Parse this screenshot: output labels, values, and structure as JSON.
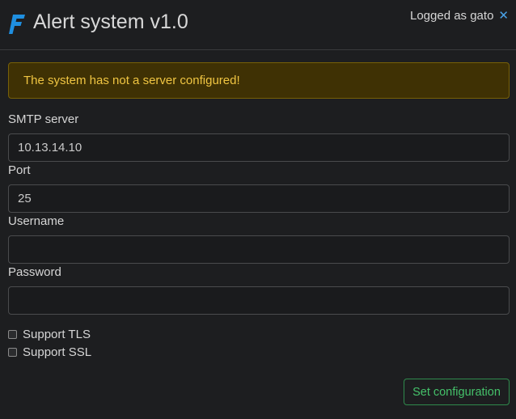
{
  "header": {
    "title": "Alert system v1.0",
    "logo_icon": "brand-f-logo-icon",
    "user_text": "Logged as gato",
    "close_glyph": "✕",
    "close_icon": "close-icon"
  },
  "alert": {
    "message": "The system has not a server configured!"
  },
  "form": {
    "smtp_label": "SMTP server",
    "smtp_value": "10.13.14.10",
    "port_label": "Port",
    "port_value": "25",
    "username_label": "Username",
    "username_value": "",
    "password_label": "Password",
    "password_value": "",
    "tls_label": "Support TLS",
    "tls_checked": false,
    "ssl_label": "Support SSL",
    "ssl_checked": false,
    "submit_label": "Set configuration"
  },
  "colors": {
    "background": "#1d1e20",
    "accent": "#4aa3e8",
    "warning_bg": "#3f3104",
    "warning_text": "#f0c542",
    "success": "#45c16a"
  }
}
